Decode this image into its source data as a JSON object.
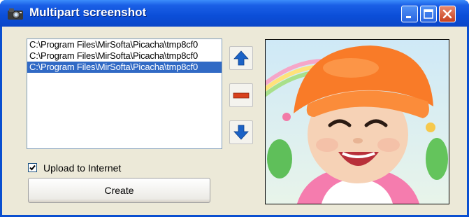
{
  "window": {
    "title": "Multipart screenshot",
    "buttons": {
      "minimize": "minimize-icon",
      "maximize": "maximize-icon",
      "close": "close-icon"
    }
  },
  "file_list": {
    "items": [
      {
        "label": "C:\\Program Files\\MirSofta\\Picacha\\tmp8cf0",
        "selected": false
      },
      {
        "label": "C:\\Program Files\\MirSofta\\Picacha\\tmp8cf0",
        "selected": false
      },
      {
        "label": "C:\\Program Files\\MirSofta\\Picacha\\tmp8cf0",
        "selected": true
      }
    ]
  },
  "side_buttons": {
    "move_up": "arrow-up-icon",
    "remove": "minus-icon",
    "move_down": "arrow-down-icon"
  },
  "upload": {
    "label": "Upload to Internet",
    "checked": true
  },
  "create": {
    "label": "Create"
  },
  "preview": {
    "subject": "preview-image"
  },
  "colors": {
    "titlebar": "#0b4ed8",
    "selection": "#316ac5",
    "arrow": "#1b62c6",
    "remove": "#d8401c"
  }
}
